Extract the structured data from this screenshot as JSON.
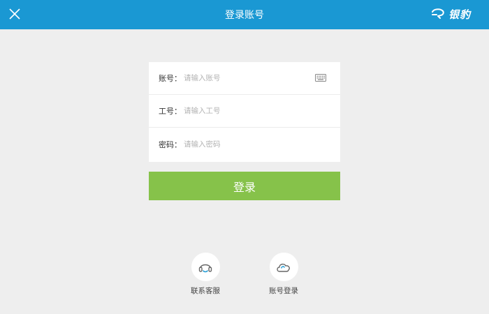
{
  "header": {
    "title": "登录账号",
    "brand_text": "银豹",
    "close_icon": "close-icon",
    "brand_icon": "brand-logo-icon",
    "background_color": "#1a98d3"
  },
  "form": {
    "rows": [
      {
        "label": "账号：",
        "placeholder": "请输入账号",
        "value": ""
      },
      {
        "label": "工号：",
        "placeholder": "请输入工号",
        "value": ""
      },
      {
        "label": "密码：",
        "placeholder": "请输入密码",
        "value": ""
      }
    ],
    "keyboard_icon": "keyboard-icon"
  },
  "login_button": {
    "label": "登录",
    "color": "#86c24a"
  },
  "options": [
    {
      "label": "联系客服",
      "icon": "headset-icon"
    },
    {
      "label": "账号登录",
      "icon": "cloud-icon"
    }
  ]
}
